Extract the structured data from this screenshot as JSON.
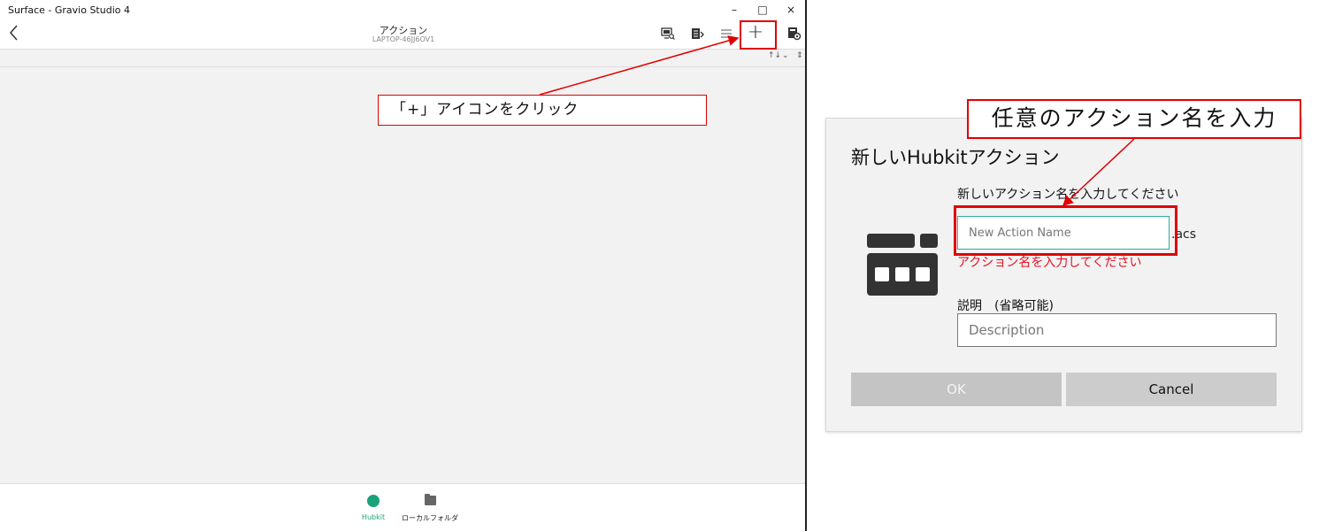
{
  "window": {
    "title": "Surface - Gravio Studio 4",
    "minimize_label": "–",
    "maximize_label": "□",
    "close_label": "×"
  },
  "header": {
    "title": "アクション",
    "subtitle": "LAPTOP-46JJ6OV1",
    "add_label": "+"
  },
  "sortbar": {
    "sort_label": "↑↓",
    "dropdown_label": "⌄",
    "updown_label": "⇕"
  },
  "bottom_nav": {
    "items": [
      {
        "label": "Hubkit",
        "active": true
      },
      {
        "label": "ローカルフォルダ",
        "active": false
      }
    ]
  },
  "annotations": {
    "callout_plus": "「+」アイコンをクリック",
    "callout_name": "任意のアクション名を入力"
  },
  "dialog": {
    "title": "新しいHubkitアクション",
    "name_label": "新しいアクション名を入力してください",
    "name_placeholder": "New Action Name",
    "extension": ".acs",
    "error_text": "アクション名を入力してください",
    "description_label": "説明　(省略可能)",
    "description_placeholder": "Description",
    "ok_label": "OK",
    "cancel_label": "Cancel"
  },
  "colors": {
    "accent": "#1aa37a",
    "annotation": "#e00000",
    "error": "#e81123",
    "input_focus": "#2eaea0"
  }
}
